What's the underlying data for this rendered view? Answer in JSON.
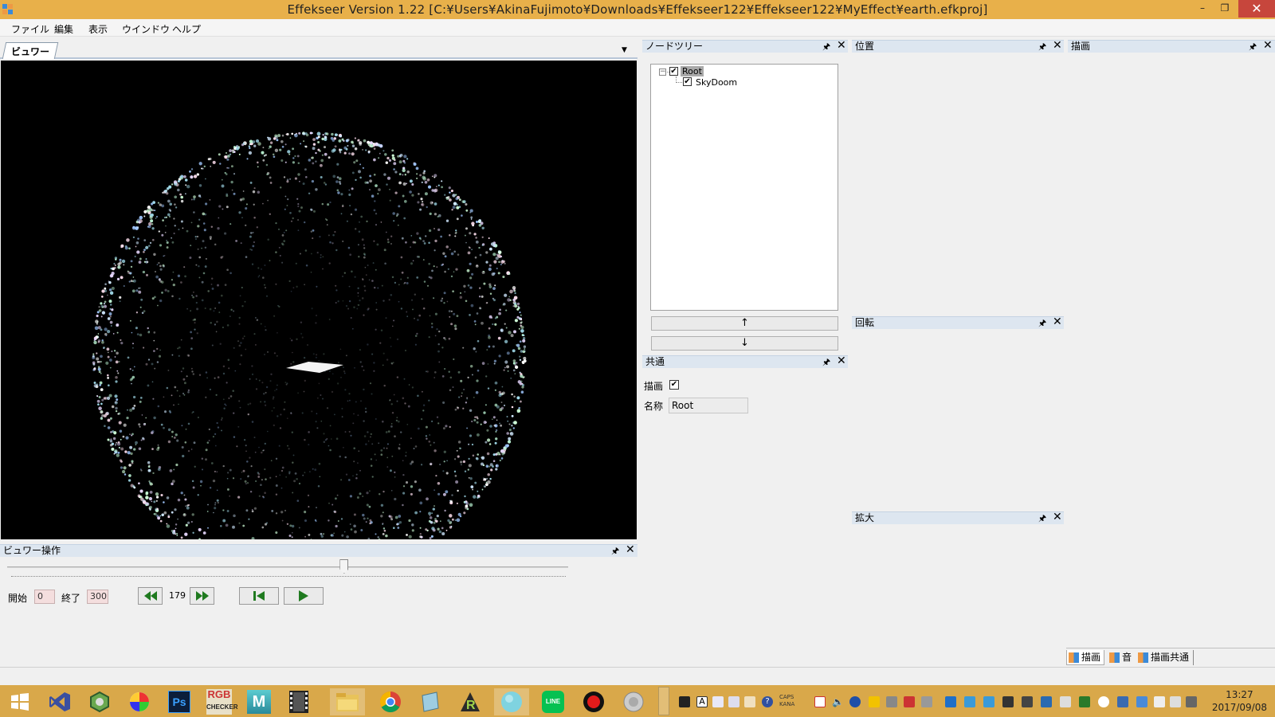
{
  "window": {
    "title": "Effekseer Version 1.22 [C:¥Users¥AkinaFujimoto¥Downloads¥Effekseer122¥Effekseer122¥MyEffect¥earth.efkproj]",
    "minimize": "–",
    "restore": "❐",
    "close": "✕"
  },
  "menu": [
    "ファイル",
    "編集",
    "表示",
    "ウインドウ",
    "ヘルプ"
  ],
  "viewer": {
    "tab_label": "ビュワー",
    "dropdown": "▼"
  },
  "panels": {
    "node_tree": "ノードツリー",
    "position": "位置",
    "draw": "描画",
    "rotation": "回転",
    "common": "共通",
    "scale": "拡大",
    "viewer_controls": "ビュワー操作",
    "pin": "🖈",
    "close": "✕"
  },
  "node_tree": {
    "expander": "−",
    "nodes": [
      {
        "label": "Root",
        "checked": true,
        "selected": true
      },
      {
        "label": "SkyDoom",
        "checked": true,
        "selected": false
      }
    ],
    "move_up": "↑",
    "move_down": "↓"
  },
  "common": {
    "draw_label": "描画",
    "draw_checked": true,
    "name_label": "名称",
    "name_value": "Root"
  },
  "viewer_controls": {
    "start_label": "開始",
    "start_value": "0",
    "end_label": "終了",
    "end_value": "300",
    "current_frame": "179",
    "slider_fraction": 0.6
  },
  "bottom_tabs": [
    "描画",
    "音",
    "描画共通"
  ],
  "taskbar": {
    "apps": [
      "windows-start",
      "visual-studio",
      "green-app",
      "color-app",
      "photoshop",
      "rgb-checker",
      "maya",
      "film-app",
      "file-explorer",
      "chrome",
      "notepad-app",
      "r-app",
      "effekseer",
      "line",
      "record-app",
      "speaker-app"
    ],
    "ps_label": "Ps",
    "maya_label": "M",
    "rgb_label": "RGB",
    "checker_label": "CHECKER",
    "line_label": "LINE",
    "caps": "CAPS",
    "kana": "KANA",
    "time": "13:27",
    "date": "2017/09/08"
  }
}
